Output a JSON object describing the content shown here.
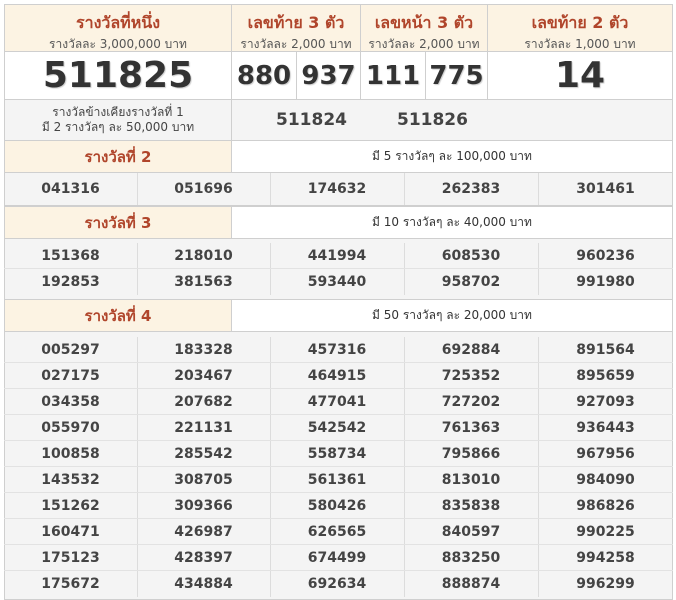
{
  "header": {
    "first": {
      "title": "รางวัลที่หนึ่ง",
      "sub": "รางวัลละ 3,000,000 บาท"
    },
    "last3": {
      "title": "เลขท้าย 3 ตัว",
      "sub": "รางวัลละ 2,000 บาท"
    },
    "front3": {
      "title": "เลขหน้า 3 ตัว",
      "sub": "รางวัลละ 2,000 บาท"
    },
    "last2": {
      "title": "เลขท้าย 2 ตัว",
      "sub": "รางวัลละ 1,000 บาท"
    }
  },
  "results": {
    "first": "511825",
    "last3": [
      "880",
      "937"
    ],
    "front3": [
      "111",
      "775"
    ],
    "last2": "14"
  },
  "side": {
    "label1": "รางวัลข้างเคียงรางวัลที่ 1",
    "label2": "มี 2 รางวัลๆ ละ 50,000 บาท",
    "numbers": [
      "511824",
      "511826"
    ]
  },
  "prize2": {
    "label": "รางวัลที่ 2",
    "desc": "มี 5 รางวัลๆ ละ 100,000 บาท",
    "numbers": [
      "041316",
      "051696",
      "174632",
      "262383",
      "301461"
    ]
  },
  "prize3": {
    "label": "รางวัลที่ 3",
    "desc": "มี 10 รางวัลๆ ละ 40,000 บาท",
    "numbers": [
      "151368",
      "218010",
      "441994",
      "608530",
      "960236",
      "192853",
      "381563",
      "593440",
      "958702",
      "991980"
    ]
  },
  "prize4": {
    "label": "รางวัลที่ 4",
    "desc": "มี 50 รางวัลๆ ละ 20,000 บาท",
    "numbers": [
      "005297",
      "183328",
      "457316",
      "692884",
      "891564",
      "027175",
      "203467",
      "464915",
      "725352",
      "895659",
      "034358",
      "207682",
      "477041",
      "727202",
      "927093",
      "055970",
      "221131",
      "542542",
      "761363",
      "936443",
      "100858",
      "285542",
      "558734",
      "795866",
      "967956",
      "143532",
      "308705",
      "561361",
      "813010",
      "984090",
      "151262",
      "309366",
      "580426",
      "835838",
      "986826",
      "160471",
      "426987",
      "626565",
      "840597",
      "990225",
      "175123",
      "428397",
      "674499",
      "883250",
      "994258",
      "175672",
      "434884",
      "692634",
      "888874",
      "996299"
    ]
  }
}
